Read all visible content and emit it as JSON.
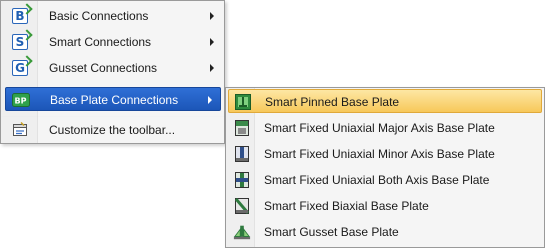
{
  "main_menu": {
    "items": [
      {
        "label": "Basic Connections",
        "icon": "basic-connections-icon",
        "letter": "B",
        "submenu": true
      },
      {
        "label": "Smart Connections",
        "icon": "smart-connections-icon",
        "letter": "S",
        "submenu": true
      },
      {
        "label": "Gusset Connections",
        "icon": "gusset-connections-icon",
        "letter": "G",
        "submenu": true
      },
      {
        "label": "Base Plate Connections",
        "icon": "base-plate-connections-icon",
        "letter": "BP",
        "submenu": true
      },
      {
        "label": "Customize the toolbar...",
        "icon": "customize-toolbar-icon",
        "submenu": false
      }
    ]
  },
  "sub_menu": {
    "items": [
      {
        "label": "Smart Pinned Base Plate",
        "icon": "pinned-base-plate-icon"
      },
      {
        "label": "Smart Fixed Uniaxial Major Axis Base Plate",
        "icon": "fixed-major-axis-base-plate-icon"
      },
      {
        "label": "Smart Fixed Uniaxial Minor Axis Base Plate",
        "icon": "fixed-minor-axis-base-plate-icon"
      },
      {
        "label": "Smart Fixed Uniaxial Both Axis Base Plate",
        "icon": "fixed-both-axis-base-plate-icon"
      },
      {
        "label": "Smart Fixed Biaxial Base Plate",
        "icon": "fixed-biaxial-base-plate-icon"
      },
      {
        "label": "Smart Gusset Base Plate",
        "icon": "gusset-base-plate-icon"
      }
    ]
  },
  "colors": {
    "hover_highlight": "#f7c85a",
    "active_highlight": "#1c56b8",
    "icon_blue": "#1f5fb3",
    "icon_green": "#3a9a3a"
  }
}
